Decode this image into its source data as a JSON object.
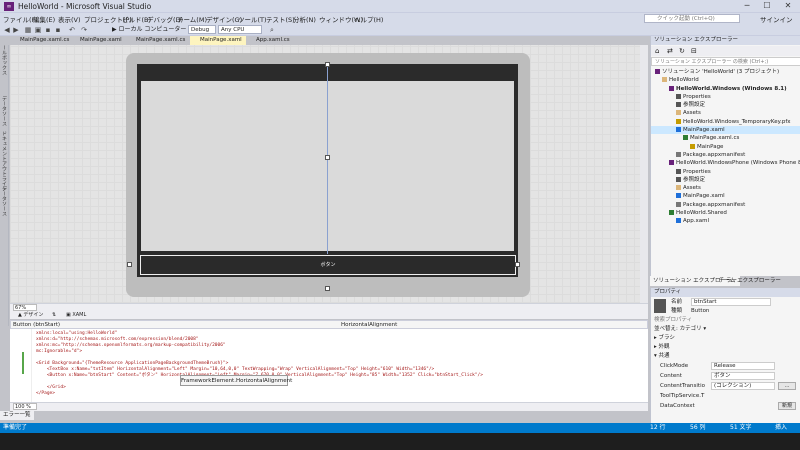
{
  "window": {
    "title": "HelloWorld - Microsoft Visual Studio",
    "minimize": "─",
    "maximize": "☐",
    "close": "✕"
  },
  "menu": [
    "ファイル(F)",
    "編集(E)",
    "表示(V)",
    "プロジェクト(P)",
    "ビルド(B)",
    "デバッグ(D)",
    "チーム(M)",
    "デザイン(G)",
    "ツール(T)",
    "テスト(S)",
    "分析(N)",
    "ウィンドウ(W)",
    "ヘルプ(H)"
  ],
  "quick_launch_placeholder": "クイック起動 (Ctrl+Q)",
  "signin": "サインイン",
  "toolbar": {
    "run_label": "▶ ローカル コンピューター",
    "config": "Debug",
    "platform": "Any CPU"
  },
  "doc_tabs": [
    "MainPage.xaml.cs",
    "MainPage.xaml",
    "MainPage.xaml.cs",
    "MainPage.xaml",
    "App.xaml.cs"
  ],
  "left_tabs": [
    "ツールボックス",
    "データソース",
    "ドキュメントアウトライン",
    "データソース"
  ],
  "designer": {
    "button_text": "ボタン",
    "zoom": "67%"
  },
  "split": {
    "design": "▲ デザイン",
    "swap": "⇅",
    "xaml": "▣ XAML"
  },
  "nav": {
    "left": "Button (btnStart)",
    "right": "HorizontalAlignment"
  },
  "code_lines": [
    {
      "t": "xmlns:local=\"using:HelloWorld\""
    },
    {
      "t": "xmlns:d=\"http://schemas.microsoft.com/expression/blend/2008\""
    },
    {
      "t": "xmlns:mc=\"http://schemas.openxmlformats.org/markup-compatibility/2006\""
    },
    {
      "t": "mc:Ignorable=\"d\">"
    },
    {
      "t": ""
    },
    {
      "t": "<Grid Background=\"{ThemeResource ApplicationPageBackgroundThemeBrush}\">"
    },
    {
      "t": "    <TextBox x:Name=\"txtItem\" HorizontalAlignment=\"Left\" Margin=\"10,64,0,0\" TextWrapping=\"Wrap\" VerticalAlignment=\"Top\" Height=\"610\" Width=\"1346\"/>"
    },
    {
      "t": "    <Button x:Name=\"btnStart\" Content=\"ボタン\" HorizontalAlignment=\"Left\" Margin=\"7,670,0,0\" VerticalAlignment=\"Top\" Height=\"85\" Width=\"1352\" Click=\"btnStart_Click\"/>"
    },
    {
      "t": ""
    },
    {
      "t": "    </Grid>"
    },
    {
      "t": "</Page>"
    }
  ],
  "tooltip": "FrameworkElement.HorizontalAlignment",
  "code_zoom": "100 %",
  "error_tab": "エラー一覧",
  "status": {
    "left": "準備完了",
    "ln": "12 行",
    "col": "56 列",
    "ch": "51 文字",
    "ins": "挿入"
  },
  "solution": {
    "header": "ソリューション エクスプローラー",
    "search": "ソリューション エクスプローラー の検索 (Ctrl+;)",
    "items": [
      {
        "label": "ソリューション 'HelloWorld' (3 プロジェクト)",
        "indent": 0,
        "icon": "solution-icon",
        "color": "#68217a",
        "sel": false
      },
      {
        "label": "HelloWorld",
        "indent": 1,
        "icon": "folder-icon",
        "color": "#dcb67a",
        "sel": false
      },
      {
        "label": "HelloWorld.Windows (Windows 8.1)",
        "indent": 2,
        "icon": "project-icon",
        "color": "#68217a",
        "sel": false,
        "bold": true
      },
      {
        "label": "Properties",
        "indent": 3,
        "icon": "wrench-icon",
        "color": "#555",
        "sel": false
      },
      {
        "label": "参照設定",
        "indent": 3,
        "icon": "reference-icon",
        "color": "#555",
        "sel": false
      },
      {
        "label": "Assets",
        "indent": 3,
        "icon": "folder-icon",
        "color": "#dcb67a",
        "sel": false
      },
      {
        "label": "HelloWorld.Windows_TemporaryKey.pfx",
        "indent": 3,
        "icon": "key-icon",
        "color": "#c59c00",
        "sel": false
      },
      {
        "label": "MainPage.xaml",
        "indent": 3,
        "icon": "xaml-icon",
        "color": "#1e6fd9",
        "sel": true
      },
      {
        "label": "MainPage.xaml.cs",
        "indent": 4,
        "icon": "cs-icon",
        "color": "#2e7d32",
        "sel": false
      },
      {
        "label": "MainPage",
        "indent": 5,
        "icon": "class-icon",
        "color": "#c59c00",
        "sel": false
      },
      {
        "label": "Package.appxmanifest",
        "indent": 3,
        "icon": "manifest-icon",
        "color": "#777",
        "sel": false
      },
      {
        "label": "HelloWorld.WindowsPhone (Windows Phone 8.1)",
        "indent": 2,
        "icon": "project-icon",
        "color": "#68217a",
        "sel": false
      },
      {
        "label": "Properties",
        "indent": 3,
        "icon": "wrench-icon",
        "color": "#555",
        "sel": false
      },
      {
        "label": "参照設定",
        "indent": 3,
        "icon": "reference-icon",
        "color": "#555",
        "sel": false
      },
      {
        "label": "Assets",
        "indent": 3,
        "icon": "folder-icon",
        "color": "#dcb67a",
        "sel": false
      },
      {
        "label": "MainPage.xaml",
        "indent": 3,
        "icon": "xaml-icon",
        "color": "#1e6fd9",
        "sel": false
      },
      {
        "label": "Package.appxmanifest",
        "indent": 3,
        "icon": "manifest-icon",
        "color": "#777",
        "sel": false
      },
      {
        "label": "HelloWorld.Shared",
        "indent": 2,
        "icon": "shared-icon",
        "color": "#2e7d32",
        "sel": false
      },
      {
        "label": "App.xaml",
        "indent": 3,
        "icon": "xaml-icon",
        "color": "#1e6fd9",
        "sel": false
      }
    ]
  },
  "panel_tabs": [
    "ソリューション エクスプローラー",
    "チーム エクスプローラー"
  ],
  "properties": {
    "header": "プロパティ",
    "name_label": "名前",
    "name_value": "btnStart",
    "type_label": "種類",
    "type_value": "Button",
    "search": "検索プロパティ",
    "arrange": "並べ替え: カテゴリ ▾",
    "categories": [
      "▸ ブラシ",
      "▸ 外観",
      "▾ 共通"
    ],
    "rows": [
      {
        "label": "ClickMode",
        "value": "Release",
        "btn": ""
      },
      {
        "label": "Content",
        "value": "ボタン",
        "btn": ""
      },
      {
        "label": "ContentTransitio",
        "value": "(コレクション)",
        "btn": "..."
      },
      {
        "label": "ToolTipService.T",
        "value": "",
        "btn": ""
      },
      {
        "label": "DataContext",
        "value": "",
        "btn": "新規"
      }
    ]
  },
  "colors": {
    "accent": "#007acc",
    "selection": "#cce8ff",
    "active_tab": "#fdf4bf"
  }
}
